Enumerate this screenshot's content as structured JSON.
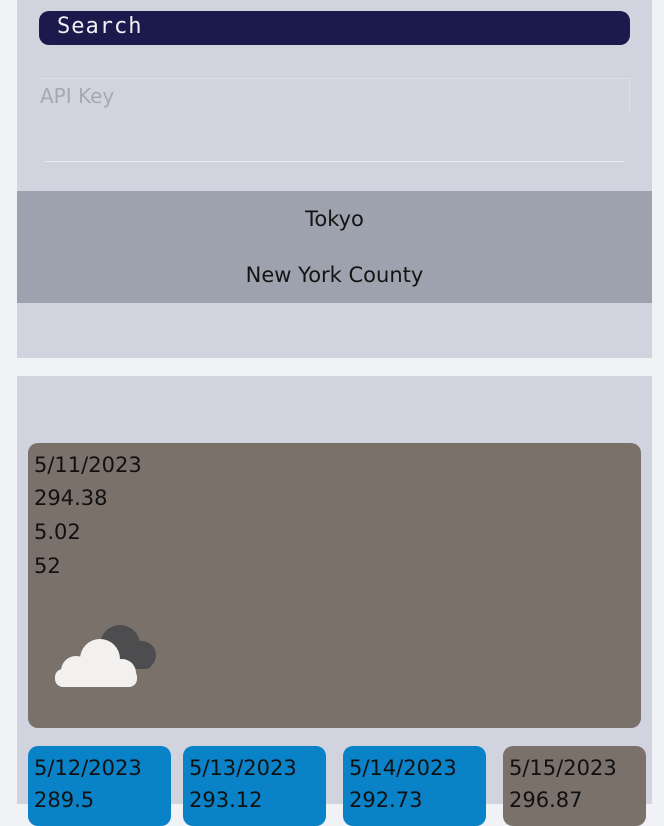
{
  "search": {
    "button_label": "Search",
    "api_key_placeholder": "API Key"
  },
  "history": [
    {
      "city": "Tokyo"
    },
    {
      "city": "New York County"
    }
  ],
  "today": {
    "date": "5/11/2023",
    "temp": "294.38",
    "wind": "5.02",
    "humidity": "52",
    "icon": "partly-cloudy-icon"
  },
  "forecast": [
    {
      "date": "5/12/2023",
      "temp": "289.5",
      "color": "#0a82c7"
    },
    {
      "date": "5/13/2023",
      "temp": "293.12",
      "color": "#0a82c7"
    },
    {
      "date": "5/14/2023",
      "temp": "292.73",
      "color": "#0a82c7"
    },
    {
      "date": "5/15/2023",
      "temp": "296.87",
      "color": "#7a716b"
    }
  ]
}
